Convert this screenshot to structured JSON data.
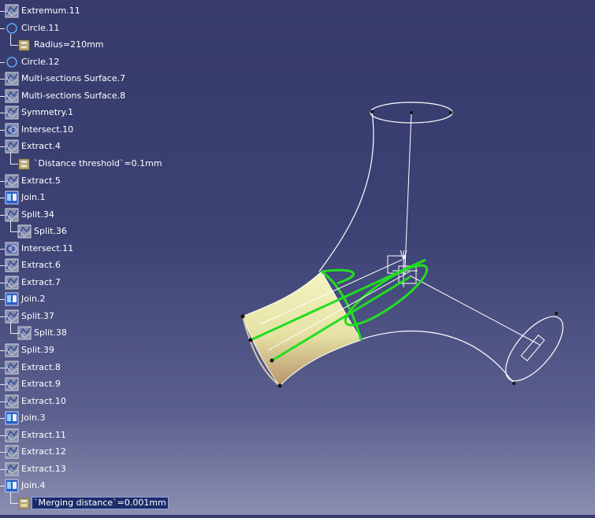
{
  "tree": {
    "items": [
      {
        "label": "Extremum.11",
        "icon": "surface-feature-icon",
        "level": 0
      },
      {
        "label": "Circle.11",
        "icon": "circle-icon",
        "level": 0
      },
      {
        "label": "Radius=210mm",
        "icon": "parameter-icon",
        "level": 1
      },
      {
        "label": "Circle.12",
        "icon": "circle-icon",
        "level": 0
      },
      {
        "label": "Multi-sections Surface.7",
        "icon": "surface-feature-icon",
        "level": 0
      },
      {
        "label": "Multi-sections Surface.8",
        "icon": "surface-feature-icon",
        "level": 0
      },
      {
        "label": "Symmetry.1",
        "icon": "surface-feature-icon",
        "level": 0
      },
      {
        "label": "Intersect.10",
        "icon": "intersect-icon",
        "level": 0
      },
      {
        "label": "Extract.4",
        "icon": "surface-feature-icon",
        "level": 0
      },
      {
        "label": "`Distance threshold`=0.1mm",
        "icon": "parameter-icon",
        "level": 1
      },
      {
        "label": "Extract.5",
        "icon": "surface-feature-icon",
        "level": 0
      },
      {
        "label": "Join.1",
        "icon": "join-icon",
        "level": 0
      },
      {
        "label": "Split.34",
        "icon": "surface-feature-icon",
        "level": 0
      },
      {
        "label": "Split.36",
        "icon": "surface-feature-icon",
        "level": 1
      },
      {
        "label": "Intersect.11",
        "icon": "intersect-icon",
        "level": 0
      },
      {
        "label": "Extract.6",
        "icon": "surface-feature-icon",
        "level": 0
      },
      {
        "label": "Extract.7",
        "icon": "surface-feature-icon",
        "level": 0
      },
      {
        "label": "Join.2",
        "icon": "join-icon",
        "level": 0
      },
      {
        "label": "Split.37",
        "icon": "surface-feature-icon",
        "level": 0
      },
      {
        "label": "Split.38",
        "icon": "surface-feature-icon",
        "level": 1
      },
      {
        "label": "Split.39",
        "icon": "surface-feature-icon",
        "level": 0
      },
      {
        "label": "Extract.8",
        "icon": "surface-feature-icon",
        "level": 0
      },
      {
        "label": "Extract.9",
        "icon": "surface-feature-icon",
        "level": 0
      },
      {
        "label": "Extract.10",
        "icon": "surface-feature-icon",
        "level": 0
      },
      {
        "label": "Join.3",
        "icon": "join-icon",
        "level": 0
      },
      {
        "label": "Extract.11",
        "icon": "surface-feature-icon",
        "level": 0
      },
      {
        "label": "Extract.12",
        "icon": "surface-feature-icon",
        "level": 0
      },
      {
        "label": "Extract.13",
        "icon": "surface-feature-icon",
        "level": 0
      },
      {
        "label": "Join.4",
        "icon": "join-icon",
        "level": 0
      },
      {
        "label": "`Merging distance`=0.001mm",
        "icon": "parameter-icon",
        "level": 1,
        "selected": true
      }
    ]
  },
  "viewport": {
    "background_top": "#363a6c",
    "background_bottom": "#8c8fb0",
    "selection_color": "#22dd22",
    "surface_color": "#e8e8b0",
    "wire_color": "#ffffff"
  }
}
